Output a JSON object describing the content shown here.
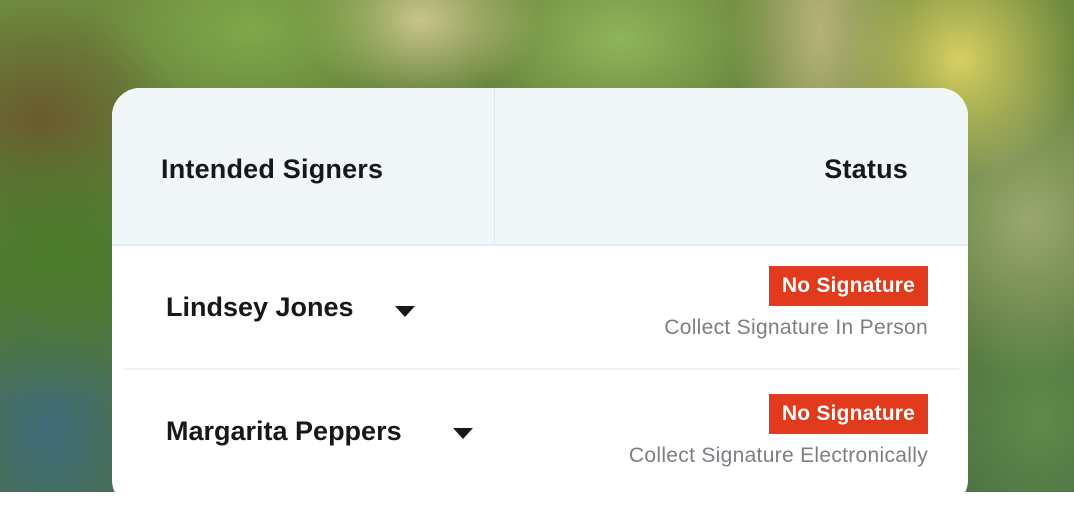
{
  "table": {
    "headers": {
      "signers": "Intended Signers",
      "status": "Status"
    },
    "rows": [
      {
        "name": "Lindsey Jones",
        "status_badge": "No Signature",
        "collection_method": "Collect Signature In Person"
      },
      {
        "name": "Margarita Peppers",
        "status_badge": "No Signature",
        "collection_method": "Collect Signature Electronically"
      }
    ]
  },
  "colors": {
    "badge_background": "#e23a1c",
    "header_background": "#f1f6f9",
    "secondary_text": "#7b7f84"
  },
  "icons": {
    "dropdown": "caret-down-icon"
  }
}
